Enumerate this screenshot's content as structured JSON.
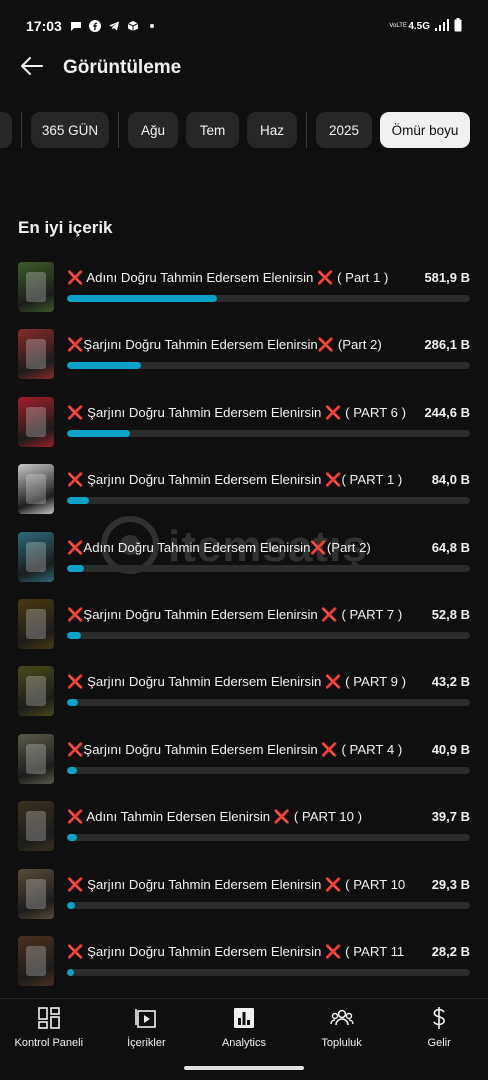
{
  "status_bar": {
    "time": "17:03",
    "network": "4.5G",
    "volte": "VoLTE",
    "left_icons": [
      "chat-bubble-icon",
      "facebook-icon",
      "telegram-icon",
      "package-icon",
      "dot-icon"
    ],
    "right_icons": [
      "signal-icon",
      "battery-icon"
    ]
  },
  "header": {
    "back_icon": "arrow-left-icon",
    "title": "Görüntüleme"
  },
  "filter_chips": [
    {
      "label": "",
      "active": false
    },
    {
      "label": "365 GÜN",
      "active": false
    },
    {
      "label": "Ağu",
      "active": false
    },
    {
      "label": "Tem",
      "active": false
    },
    {
      "label": "Haz",
      "active": false
    },
    {
      "label": "2025",
      "active": false
    },
    {
      "label": "Ömür boyu",
      "active": true
    }
  ],
  "section_title": "En iyi içerik",
  "top_content": [
    {
      "prefix": "❌",
      "title": " Adını Doğru Tahmin Edersem Elenirsin ",
      "suffix_mark": "❌",
      "suffix": " ( Part 1 )",
      "value": "581,9 B",
      "fraction": 0.372,
      "thumb_color": "#3d5a2a"
    },
    {
      "prefix": "❌",
      "title": "Şarjını Doğru Tahmin Edersem Elenirsin",
      "suffix_mark": "❌",
      "suffix": " (Part 2)",
      "value": "286,1 B",
      "fraction": 0.184,
      "thumb_color": "#8a2a2a"
    },
    {
      "prefix": "❌",
      "title": " Şarjını Doğru Tahmin Edersem Elenirsin ",
      "suffix_mark": "❌",
      "suffix": " ( PART 6 )",
      "value": "244,6 B",
      "fraction": 0.157,
      "thumb_color": "#a01f2a"
    },
    {
      "prefix": "❌",
      "title": " Şarjını Doğru Tahmin Edersem Elenirsin ",
      "suffix_mark": "❌",
      "suffix": "( PART 1 )",
      "value": "84,0 B",
      "fraction": 0.054,
      "thumb_color": "#c8c8c8"
    },
    {
      "prefix": "❌",
      "title": "Adını Doğru Tahmin Edersem Elenirsin",
      "suffix_mark": "❌",
      "suffix": "(Part 2)",
      "value": "64,8 B",
      "fraction": 0.042,
      "thumb_color": "#2a6a7a"
    },
    {
      "prefix": "❌",
      "title": "Şarjını Doğru Tahmin Edersem Elenirsin ",
      "suffix_mark": "❌",
      "suffix": " ( PART 7 )",
      "value": "52,8 B",
      "fraction": 0.034,
      "thumb_color": "#4a3a10"
    },
    {
      "prefix": "❌",
      "title": " Şarjını Doğru Tahmin Edersem Elenirsin ",
      "suffix_mark": "❌",
      "suffix": " ( PART 9 )",
      "value": "43,2 B",
      "fraction": 0.028,
      "thumb_color": "#4a4a1a"
    },
    {
      "prefix": "❌",
      "title": "Şarjını Doğru Tahmin Edersem Elenirsin ",
      "suffix_mark": "❌",
      "suffix": " ( PART 4 )",
      "value": "40,9 B",
      "fraction": 0.026,
      "thumb_color": "#5a5a4a"
    },
    {
      "prefix": "❌",
      "title": " Adını Tahmin Edersen Elenirsin ",
      "suffix_mark": "❌",
      "suffix": " ( PART 10 )",
      "value": "39,7 B",
      "fraction": 0.025,
      "thumb_color": "#3a3020"
    },
    {
      "prefix": "❌",
      "title": " Şarjını Doğru Tahmin Edersem Elenirsin ",
      "suffix_mark": "❌",
      "suffix": " ( PART 10 )",
      "value": "29,3 B",
      "fraction": 0.019,
      "thumb_color": "#5a4a3a"
    },
    {
      "prefix": "❌",
      "title": " Şarjını Doğru Tahmin Edersem Elenirsin ",
      "suffix_mark": "❌",
      "suffix": " ( PART 11 )",
      "value": "28,2 B",
      "fraction": 0.018,
      "thumb_color": "#4a3020"
    }
  ],
  "watermark": {
    "text": "itemsatış"
  },
  "bottom_nav": [
    {
      "label": "Kontrol Paneli",
      "icon": "dashboard-icon"
    },
    {
      "label": "İçerikler",
      "icon": "content-icon"
    },
    {
      "label": "Analytics",
      "icon": "analytics-icon",
      "active": true
    },
    {
      "label": "Topluluk",
      "icon": "community-icon"
    },
    {
      "label": "Gelir",
      "icon": "dollar-icon"
    }
  ],
  "colors": {
    "accent": "#0aa1c8",
    "background": "#0f0f0f",
    "chip": "#272727",
    "track": "#2c2c2c"
  }
}
